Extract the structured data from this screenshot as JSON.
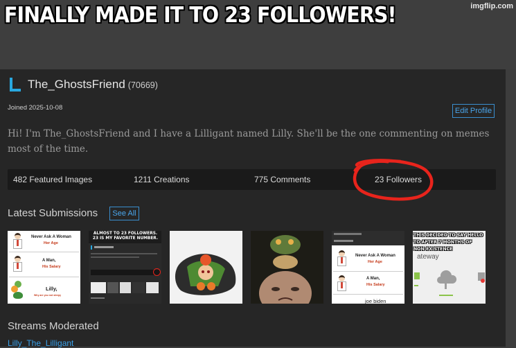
{
  "meme": {
    "caption": "FINALLY MADE IT TO 23 FOLLOWERS!",
    "watermark": "imgflip.com"
  },
  "profile": {
    "username": "The_GhostsFriend",
    "points": "(70669)",
    "joined": "Joined 2025-10-08",
    "edit_label": "Edit Profile",
    "bio": "Hi! I'm The_GhostsFriend and I have a Lilligant named Lilly. She'll be the one commenting on memes most of the time.",
    "logo_color": "#29a8e0"
  },
  "stats": {
    "featured": "482 Featured Images",
    "creations": "1211 Creations",
    "comments": "775 Comments",
    "followers": "23 Followers",
    "highlight_color": "#e8241c"
  },
  "submissions": {
    "title": "Latest Submissions",
    "see_all": "See All",
    "thumb1": {
      "t1": "Never Ask A Woman",
      "s1": "Her Age",
      "t2": "A Man,",
      "s2": "His Salary",
      "t3": "Lilly,",
      "s3": "Why are you not sleepy"
    },
    "thumb2": {
      "caption": "ALMOST TO 23 FOLLOWERS. 23 IS MY FAVORITE NUMBER."
    },
    "thumb5": {
      "t1": "Never Ask A Woman",
      "s1": "Her Age",
      "t2": "A Man,",
      "s2": "His Salary",
      "t3": "joe biden"
    },
    "thumb6": {
      "caption": "THIS DECIDED TO SAY HELLO TO AFTER 7 MONTHS OF NON-EXISTENCE",
      "label": "ateway"
    }
  },
  "streams": {
    "title": "Streams Moderated",
    "link": "Lilly_The_Lilligant"
  }
}
